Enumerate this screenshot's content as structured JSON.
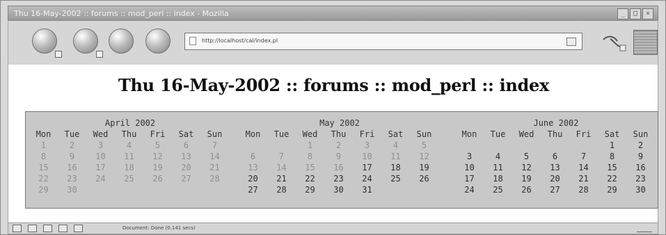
{
  "window": {
    "title": "Thu 16-May-2002 :: forums :: mod_perl :: index - Mozilla",
    "controls": [
      "_",
      "□",
      "×"
    ]
  },
  "toolbar": {
    "address": "http://localhost/cal/index.pl",
    "icons": [
      "back-icon",
      "forward-icon",
      "reload-icon",
      "stop-icon",
      "go-icon",
      "sidebar-icon"
    ]
  },
  "page": {
    "heading": "Thu 16-May-2002 :: forums :: mod_perl :: index"
  },
  "calendar": {
    "weekday_headers": [
      "Mon",
      "Tue",
      "Wed",
      "Thu",
      "Fri",
      "Sat",
      "Sun"
    ],
    "months": [
      {
        "title": "April 2002",
        "weeks": [
          [
            "1",
            "2",
            "3",
            "4",
            "5",
            "6",
            "7"
          ],
          [
            "8",
            "9",
            "10",
            "11",
            "12",
            "13",
            "14"
          ],
          [
            "15",
            "16",
            "17",
            "18",
            "19",
            "20",
            "21"
          ],
          [
            "22",
            "23",
            "24",
            "25",
            "26",
            "27",
            "28"
          ],
          [
            "29",
            "30",
            "",
            "",
            "",
            "",
            ""
          ]
        ]
      },
      {
        "title": "May 2002",
        "weeks": [
          [
            "",
            "",
            "1",
            "2",
            "3",
            "4",
            "5"
          ],
          [
            "6",
            "7",
            "8",
            "9",
            "10",
            "11",
            "12"
          ],
          [
            "13",
            "14",
            "15",
            "16",
            "17",
            "18",
            "19"
          ],
          [
            "20",
            "21",
            "22",
            "23",
            "24",
            "25",
            "26"
          ],
          [
            "27",
            "28",
            "29",
            "30",
            "31",
            "",
            ""
          ]
        ]
      },
      {
        "title": "June 2002",
        "weeks": [
          [
            "",
            "",
            "",
            "",
            "",
            "1",
            "2"
          ],
          [
            "3",
            "4",
            "5",
            "6",
            "7",
            "8",
            "9"
          ],
          [
            "10",
            "11",
            "12",
            "13",
            "14",
            "15",
            "16"
          ],
          [
            "17",
            "18",
            "19",
            "20",
            "21",
            "22",
            "23"
          ],
          [
            "24",
            "25",
            "26",
            "27",
            "28",
            "29",
            "30"
          ]
        ]
      }
    ]
  },
  "statusbar": {
    "text": "Document: Done (0.141 secs)"
  }
}
